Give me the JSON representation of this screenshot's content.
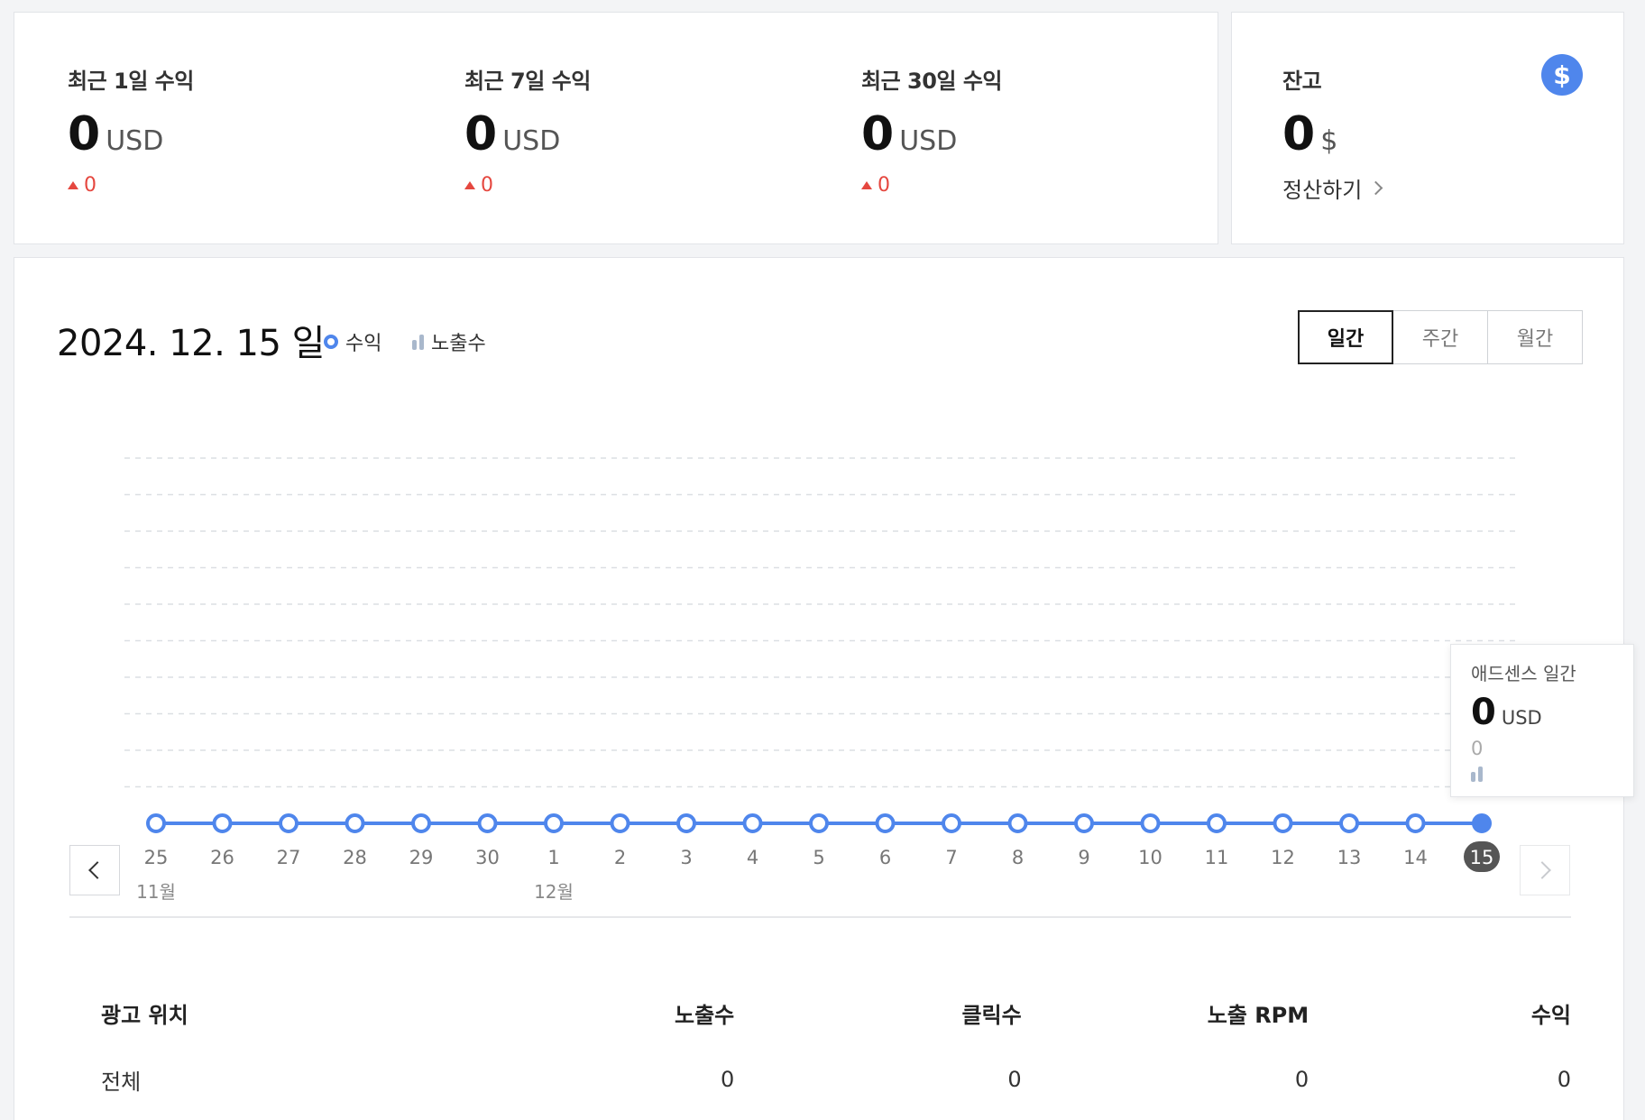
{
  "summary": {
    "stats": [
      {
        "label": "최근 1일 수익",
        "value": "0",
        "unit": "USD",
        "change": "0"
      },
      {
        "label": "최근 7일 수익",
        "value": "0",
        "unit": "USD",
        "change": "0"
      },
      {
        "label": "최근 30일 수익",
        "value": "0",
        "unit": "USD",
        "change": "0"
      }
    ]
  },
  "balance": {
    "label": "잔고",
    "value": "0",
    "unit": "$",
    "icon": "dollar-icon",
    "icon_glyph": "$",
    "settle_label": "정산하기"
  },
  "chart": {
    "date_title": "2024. 12. 15 일",
    "legend": {
      "revenue": "수익",
      "impressions": "노출수"
    },
    "tabs": {
      "daily": "일간",
      "weekly": "주간",
      "monthly": "월간",
      "active": "daily"
    },
    "tooltip": {
      "title": "애드센스 일간",
      "value": "0",
      "unit": "USD",
      "impressions": "0"
    },
    "month_labels": {
      "nov": "11월",
      "dec": "12월"
    },
    "accent_color": "#4f86ec"
  },
  "chart_data": {
    "type": "line",
    "x": [
      "25",
      "26",
      "27",
      "28",
      "29",
      "30",
      "1",
      "2",
      "3",
      "4",
      "5",
      "6",
      "7",
      "8",
      "9",
      "10",
      "11",
      "12",
      "13",
      "14",
      "15"
    ],
    "series": [
      {
        "name": "수익",
        "values": [
          0,
          0,
          0,
          0,
          0,
          0,
          0,
          0,
          0,
          0,
          0,
          0,
          0,
          0,
          0,
          0,
          0,
          0,
          0,
          0,
          0
        ]
      }
    ],
    "selected_x": "15",
    "grid": true
  },
  "table": {
    "headers": [
      "광고 위치",
      "노출수",
      "클릭수",
      "노출 RPM",
      "수익"
    ],
    "rows": [
      [
        "전체",
        "0",
        "0",
        "0",
        "0"
      ]
    ]
  }
}
